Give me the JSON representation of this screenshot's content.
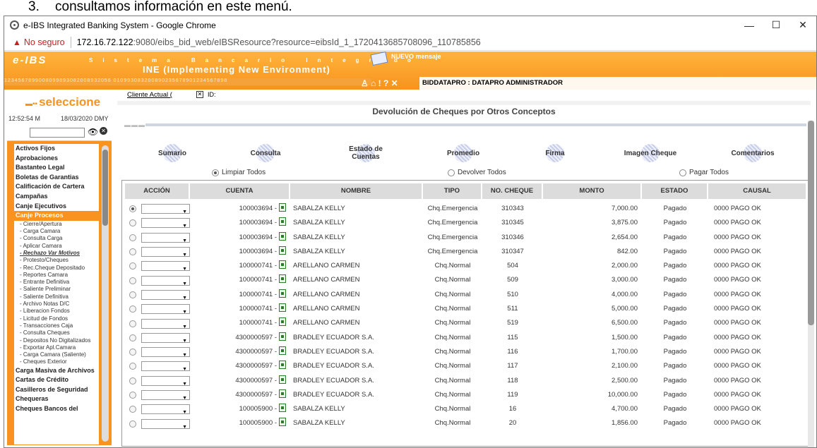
{
  "caption": {
    "number": "3.",
    "text": "consultamos información en este menú."
  },
  "window": {
    "title": "e-IBS Integrated Banking System - Google Chrome",
    "minimize": "—",
    "maximize": "☐",
    "close": "✕"
  },
  "address": {
    "warning": "▲",
    "not_secure": "No seguro",
    "host": "172.16.72.122",
    "path": ":9080/eibs_bid_web/eIBSResource?resource=eibsId_1_1720413685708096_110785856"
  },
  "header": {
    "logo": "e-IBS",
    "sistema": "Sistema Bancario Integrado",
    "ine": "INE (Implementing New Environment)",
    "nums": "1234567899008099893082008932056 010993083200890235678901234567898",
    "message": "NUEVO mensaje",
    "tools": "♙ ⌂ ! ? ✕",
    "user": "BIDDATAPRO : DATAPRO ADMINISTRADOR"
  },
  "sidebar": {
    "title": "seleccione",
    "time": "12:52:54 M",
    "date": "18/03/2020 DMY",
    "menu_top": [
      "Activos Fijos",
      "Aprobaciones",
      "Bastanteo Legal",
      "Boletas de Garantias",
      "Calificación de Cartera",
      "Campañas",
      "Canje Ejecutivos"
    ],
    "menu_active": "Canje Procesos",
    "submenu": [
      "- Cierre/Apertura",
      "- Carga Camara",
      "- Consulta Carga",
      "- Aplicar Camara",
      "- Rechazo Var Motivos",
      "- Protesto/Cheques",
      "- Rec.Cheque Depositado",
      "- Reportes Camara",
      "- Entrante Definitiva",
      "- Saliente Preliminar",
      "- Saliente Definitiva",
      "- Archivo Notas D/C",
      "- Liberacion Fondos",
      "- Licitud de Fondos",
      "- Transacciones Caja",
      "- Consulta Cheques",
      "- Depositos No Digitalizados",
      "- Exportar Apl.Camara",
      "- Carga Camara (Saliente)",
      "- Cheques Exterior"
    ],
    "submenu_selected": "- Rechazo Var Motivos",
    "menu_bottom": [
      "Carga Masiva de Archivos",
      "Cartas de Crédito",
      "Casilleros de Seguridad",
      "Chequeras",
      "Cheques Bancos del"
    ]
  },
  "content": {
    "cliente": "Cliente Actual (",
    "id_label": "ID:",
    "title": "Devolución de Cheques por Otros Conceptos",
    "dashes": "▬▬▬",
    "tabs": [
      "Sumario",
      "Consulta",
      "Estado de Cuentas",
      "Promedio",
      "Firma",
      "Imagen Cheque",
      "Comentarios"
    ],
    "radios": [
      "Limpiar Todos",
      "Devolver Todos",
      "Pagar Todos"
    ],
    "columns": [
      "ACCIÓN",
      "CUENTA",
      "NOMBRE",
      "TIPO",
      "NO. CHEQUE",
      "MONTO",
      "ESTADO",
      "CAUSAL"
    ],
    "rows": [
      {
        "cuenta": "100003694 -",
        "nombre": "SABALZA KELLY",
        "tipo": "Chq.Emergencia",
        "cheque": "310343",
        "monto": "7,000.00",
        "estado": "Pagado",
        "causal": "0000 PAGO OK"
      },
      {
        "cuenta": "100003694 -",
        "nombre": "SABALZA KELLY",
        "tipo": "Chq.Emergencia",
        "cheque": "310345",
        "monto": "3,875.00",
        "estado": "Pagado",
        "causal": "0000 PAGO OK"
      },
      {
        "cuenta": "100003694 -",
        "nombre": "SABALZA KELLY",
        "tipo": "Chq.Emergencia",
        "cheque": "310346",
        "monto": "2,654.00",
        "estado": "Pagado",
        "causal": "0000 PAGO OK"
      },
      {
        "cuenta": "100003694 -",
        "nombre": "SABALZA KELLY",
        "tipo": "Chq.Emergencia",
        "cheque": "310347",
        "monto": "842.00",
        "estado": "Pagado",
        "causal": "0000 PAGO OK"
      },
      {
        "cuenta": "100000741 -",
        "nombre": "ARELLANO CARMEN",
        "tipo": "Chq.Normal",
        "cheque": "504",
        "monto": "2,000.00",
        "estado": "Pagado",
        "causal": "0000 PAGO OK"
      },
      {
        "cuenta": "100000741 -",
        "nombre": "ARELLANO CARMEN",
        "tipo": "Chq.Normal",
        "cheque": "509",
        "monto": "3,000.00",
        "estado": "Pagado",
        "causal": "0000 PAGO OK"
      },
      {
        "cuenta": "100000741 -",
        "nombre": "ARELLANO CARMEN",
        "tipo": "Chq.Normal",
        "cheque": "510",
        "monto": "4,000.00",
        "estado": "Pagado",
        "causal": "0000 PAGO OK"
      },
      {
        "cuenta": "100000741 -",
        "nombre": "ARELLANO CARMEN",
        "tipo": "Chq.Normal",
        "cheque": "511",
        "monto": "5,000.00",
        "estado": "Pagado",
        "causal": "0000 PAGO OK"
      },
      {
        "cuenta": "100000741 -",
        "nombre": "ARELLANO CARMEN",
        "tipo": "Chq.Normal",
        "cheque": "519",
        "monto": "6,500.00",
        "estado": "Pagado",
        "causal": "0000 PAGO OK"
      },
      {
        "cuenta": "4300000597 -",
        "nombre": "BRADLEY ECUADOR S.A.",
        "tipo": "Chq.Normal",
        "cheque": "115",
        "monto": "1,500.00",
        "estado": "Pagado",
        "causal": "0000 PAGO OK"
      },
      {
        "cuenta": "4300000597 -",
        "nombre": "BRADLEY ECUADOR S.A.",
        "tipo": "Chq.Normal",
        "cheque": "116",
        "monto": "1,700.00",
        "estado": "Pagado",
        "causal": "0000 PAGO OK"
      },
      {
        "cuenta": "4300000597 -",
        "nombre": "BRADLEY ECUADOR S.A.",
        "tipo": "Chq.Normal",
        "cheque": "117",
        "monto": "2,100.00",
        "estado": "Pagado",
        "causal": "0000 PAGO OK"
      },
      {
        "cuenta": "4300000597 -",
        "nombre": "BRADLEY ECUADOR S.A.",
        "tipo": "Chq.Normal",
        "cheque": "118",
        "monto": "2,500.00",
        "estado": "Pagado",
        "causal": "0000 PAGO OK"
      },
      {
        "cuenta": "4300000597 -",
        "nombre": "BRADLEY ECUADOR S.A.",
        "tipo": "Chq.Normal",
        "cheque": "119",
        "monto": "10,000.00",
        "estado": "Pagado",
        "causal": "0000 PAGO OK"
      },
      {
        "cuenta": "100005900 -",
        "nombre": "SABALZA KELLY",
        "tipo": "Chq.Normal",
        "cheque": "16",
        "monto": "4,700.00",
        "estado": "Pagado",
        "causal": "0000 PAGO OK"
      },
      {
        "cuenta": "100005900 -",
        "nombre": "SABALZA KELLY",
        "tipo": "Chq.Normal",
        "cheque": "20",
        "monto": "1,856.00",
        "estado": "Pagado",
        "causal": "0000 PAGO OK"
      }
    ]
  }
}
